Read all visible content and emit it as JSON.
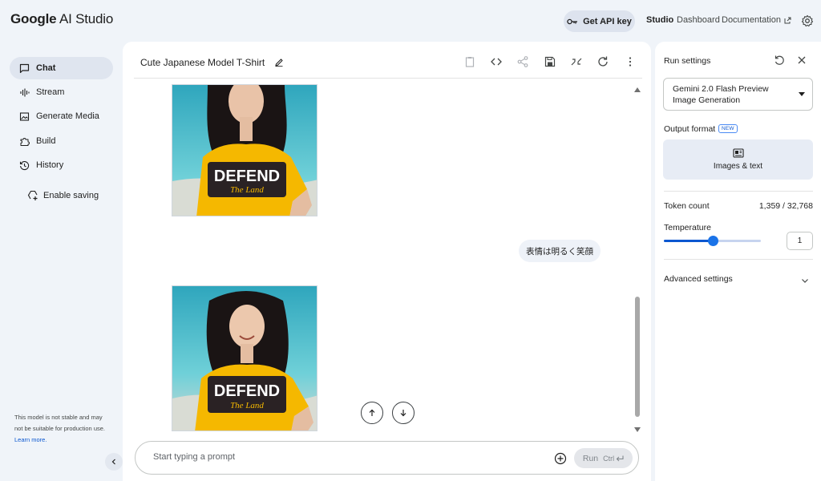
{
  "app": {
    "brand_google": "Google",
    "brand_product": " AI Studio",
    "api_key_label": "Get API key",
    "nav": {
      "studio": "Studio",
      "dashboard": "Dashboard",
      "documentation": "Documentation"
    }
  },
  "sidebar": {
    "items": [
      {
        "label": "Chat",
        "icon": "chat-icon",
        "active": true
      },
      {
        "label": "Stream",
        "icon": "stream-icon",
        "active": false
      },
      {
        "label": "Generate Media",
        "icon": "image-icon",
        "active": false
      },
      {
        "label": "Build",
        "icon": "build-icon",
        "active": false
      },
      {
        "label": "History",
        "icon": "history-icon",
        "active": false
      }
    ],
    "enable_saving": "Enable saving",
    "disclaimer": "This model is not stable and may not be suitable for production use.",
    "learn_more": "Learn more."
  },
  "main": {
    "title": "Cute Japanese Model T-Shirt",
    "messages": [
      {
        "role": "model",
        "type": "image",
        "shirt_text_top": "DEFEND",
        "shirt_text_bottom": "The Land"
      },
      {
        "role": "user",
        "type": "text",
        "text": "表情は明るく笑顔"
      },
      {
        "role": "model",
        "type": "image",
        "shirt_text_top": "DEFEND",
        "shirt_text_bottom": "The Land"
      }
    ],
    "prompt": {
      "placeholder": "Start typing a prompt",
      "run_label": "Run",
      "shortcut": "Ctrl"
    }
  },
  "run_settings": {
    "title": "Run settings",
    "model": "Gemini 2.0 Flash Preview Image Generation",
    "output_format_label": "Output format",
    "new_badge": "NEW",
    "output_format_value": "Images & text",
    "token_count_label": "Token count",
    "token_count_value": "1,359 / 32,768",
    "temperature_label": "Temperature",
    "temperature_value": "1",
    "temperature_fraction": 0.5,
    "advanced_label": "Advanced settings"
  },
  "colors": {
    "accent": "#0b57d0",
    "background": "#f0f4f9",
    "shirt": "#f5b800",
    "sea": "#3fb5c6"
  }
}
